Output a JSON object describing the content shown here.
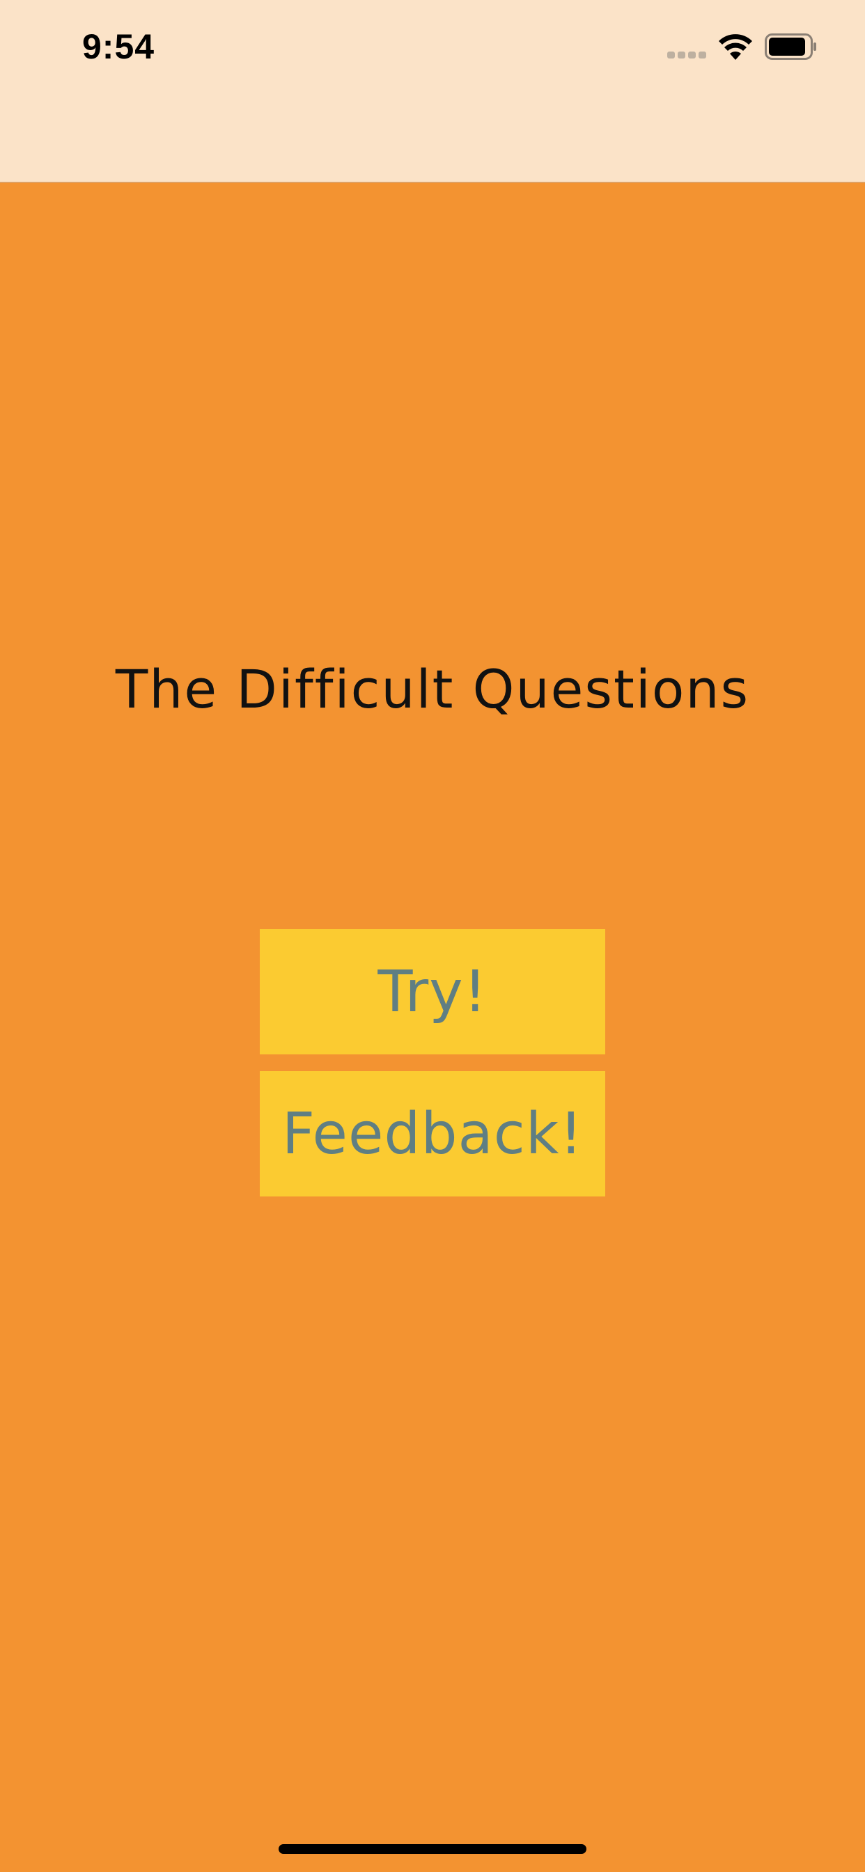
{
  "status_bar": {
    "time": "9:54",
    "icons": [
      "cellular-signal-icon",
      "wifi-icon",
      "battery-icon"
    ]
  },
  "main": {
    "title": "The Difficult Questions",
    "buttons": {
      "try_label": "Try!",
      "feedback_label": "Feedback!"
    }
  },
  "colors": {
    "background": "#F39331",
    "status_bar_background": "#FBE3C8",
    "button_background": "#FBCB31",
    "button_text": "#5F7E83",
    "title_text": "#111111"
  }
}
